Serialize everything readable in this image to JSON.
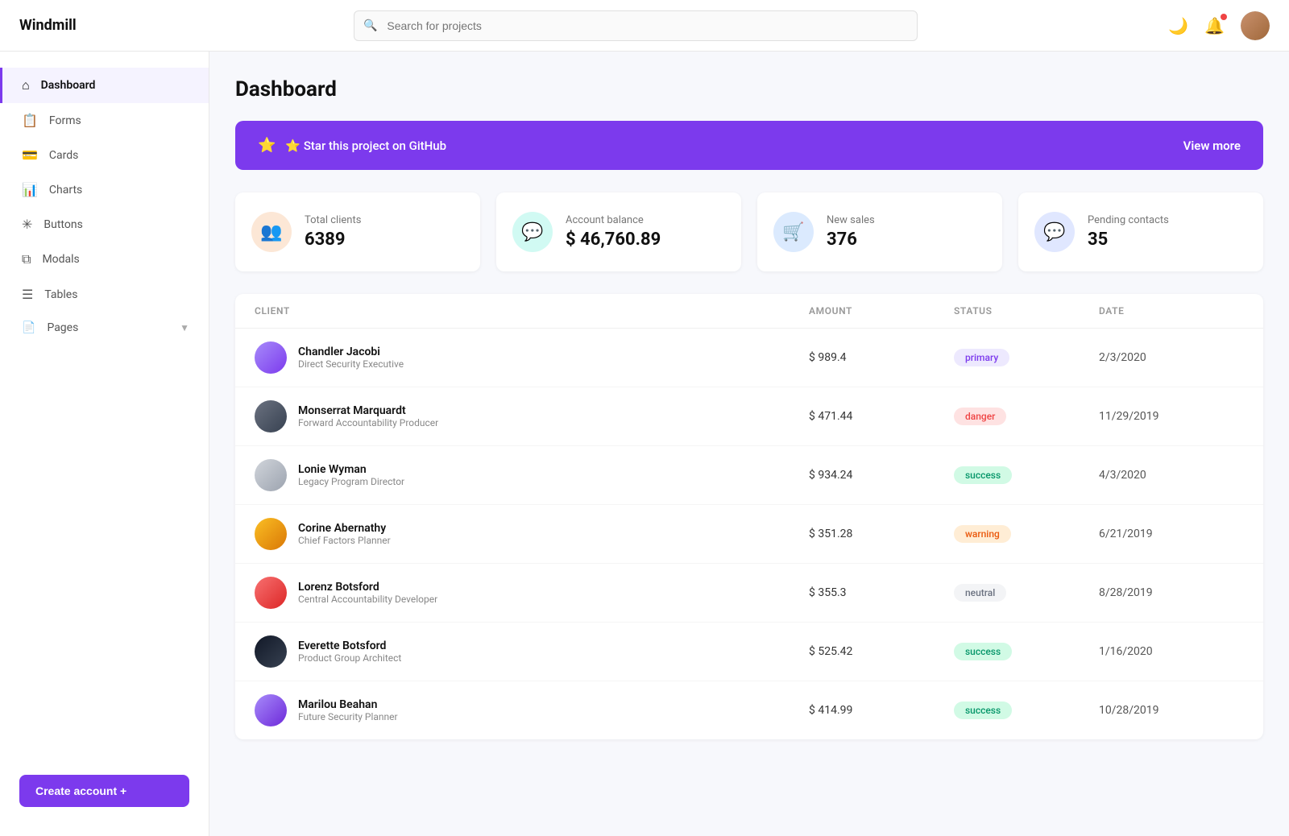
{
  "app": {
    "logo": "Windmill"
  },
  "topbar": {
    "search_placeholder": "Search for projects",
    "theme_icon": "🌙",
    "notif_icon": "🔔"
  },
  "sidebar": {
    "items": [
      {
        "id": "dashboard",
        "label": "Dashboard",
        "icon": "⌂",
        "active": true
      },
      {
        "id": "forms",
        "label": "Forms",
        "icon": "📋",
        "active": false
      },
      {
        "id": "cards",
        "label": "Cards",
        "icon": "💳",
        "active": false
      },
      {
        "id": "charts",
        "label": "Charts",
        "icon": "📊",
        "active": false
      },
      {
        "id": "buttons",
        "label": "Buttons",
        "icon": "✳",
        "active": false
      },
      {
        "id": "modals",
        "label": "Modals",
        "icon": "⧉",
        "active": false
      },
      {
        "id": "tables",
        "label": "Tables",
        "icon": "☰",
        "active": false
      },
      {
        "id": "pages",
        "label": "Pages",
        "icon": "📄",
        "active": false
      }
    ],
    "create_button": "Create account +"
  },
  "banner": {
    "star_label": "⭐ Star this project on GitHub",
    "link_label": "View more"
  },
  "page_title": "Dashboard",
  "stats": [
    {
      "id": "total-clients",
      "label": "Total clients",
      "value": "6389",
      "icon": "👥",
      "color": "orange"
    },
    {
      "id": "account-balance",
      "label": "Account balance",
      "value": "$ 46,760.89",
      "icon": "💬",
      "color": "teal"
    },
    {
      "id": "new-sales",
      "label": "New sales",
      "value": "376",
      "icon": "🛒",
      "color": "blue"
    },
    {
      "id": "pending-contacts",
      "label": "Pending contacts",
      "value": "35",
      "icon": "💬",
      "color": "purple"
    }
  ],
  "table": {
    "headers": [
      "CLIENT",
      "AMOUNT",
      "STATUS",
      "DATE"
    ],
    "rows": [
      {
        "name": "Chandler Jacobi",
        "role": "Direct Security Executive",
        "amount": "$ 989.4",
        "status": "primary",
        "date": "2/3/2020",
        "av": "av1"
      },
      {
        "name": "Monserrat Marquardt",
        "role": "Forward Accountability Producer",
        "amount": "$ 471.44",
        "status": "danger",
        "date": "11/29/2019",
        "av": "av2"
      },
      {
        "name": "Lonie Wyman",
        "role": "Legacy Program Director",
        "amount": "$ 934.24",
        "status": "success",
        "date": "4/3/2020",
        "av": "av3"
      },
      {
        "name": "Corine Abernathy",
        "role": "Chief Factors Planner",
        "amount": "$ 351.28",
        "status": "warning",
        "date": "6/21/2019",
        "av": "av4"
      },
      {
        "name": "Lorenz Botsford",
        "role": "Central Accountability Developer",
        "amount": "$ 355.3",
        "status": "neutral",
        "date": "8/28/2019",
        "av": "av5"
      },
      {
        "name": "Everette Botsford",
        "role": "Product Group Architect",
        "amount": "$ 525.42",
        "status": "success",
        "date": "1/16/2020",
        "av": "av6"
      },
      {
        "name": "Marilou Beahan",
        "role": "Future Security Planner",
        "amount": "$ 414.99",
        "status": "success",
        "date": "10/28/2019",
        "av": "av7"
      }
    ]
  }
}
